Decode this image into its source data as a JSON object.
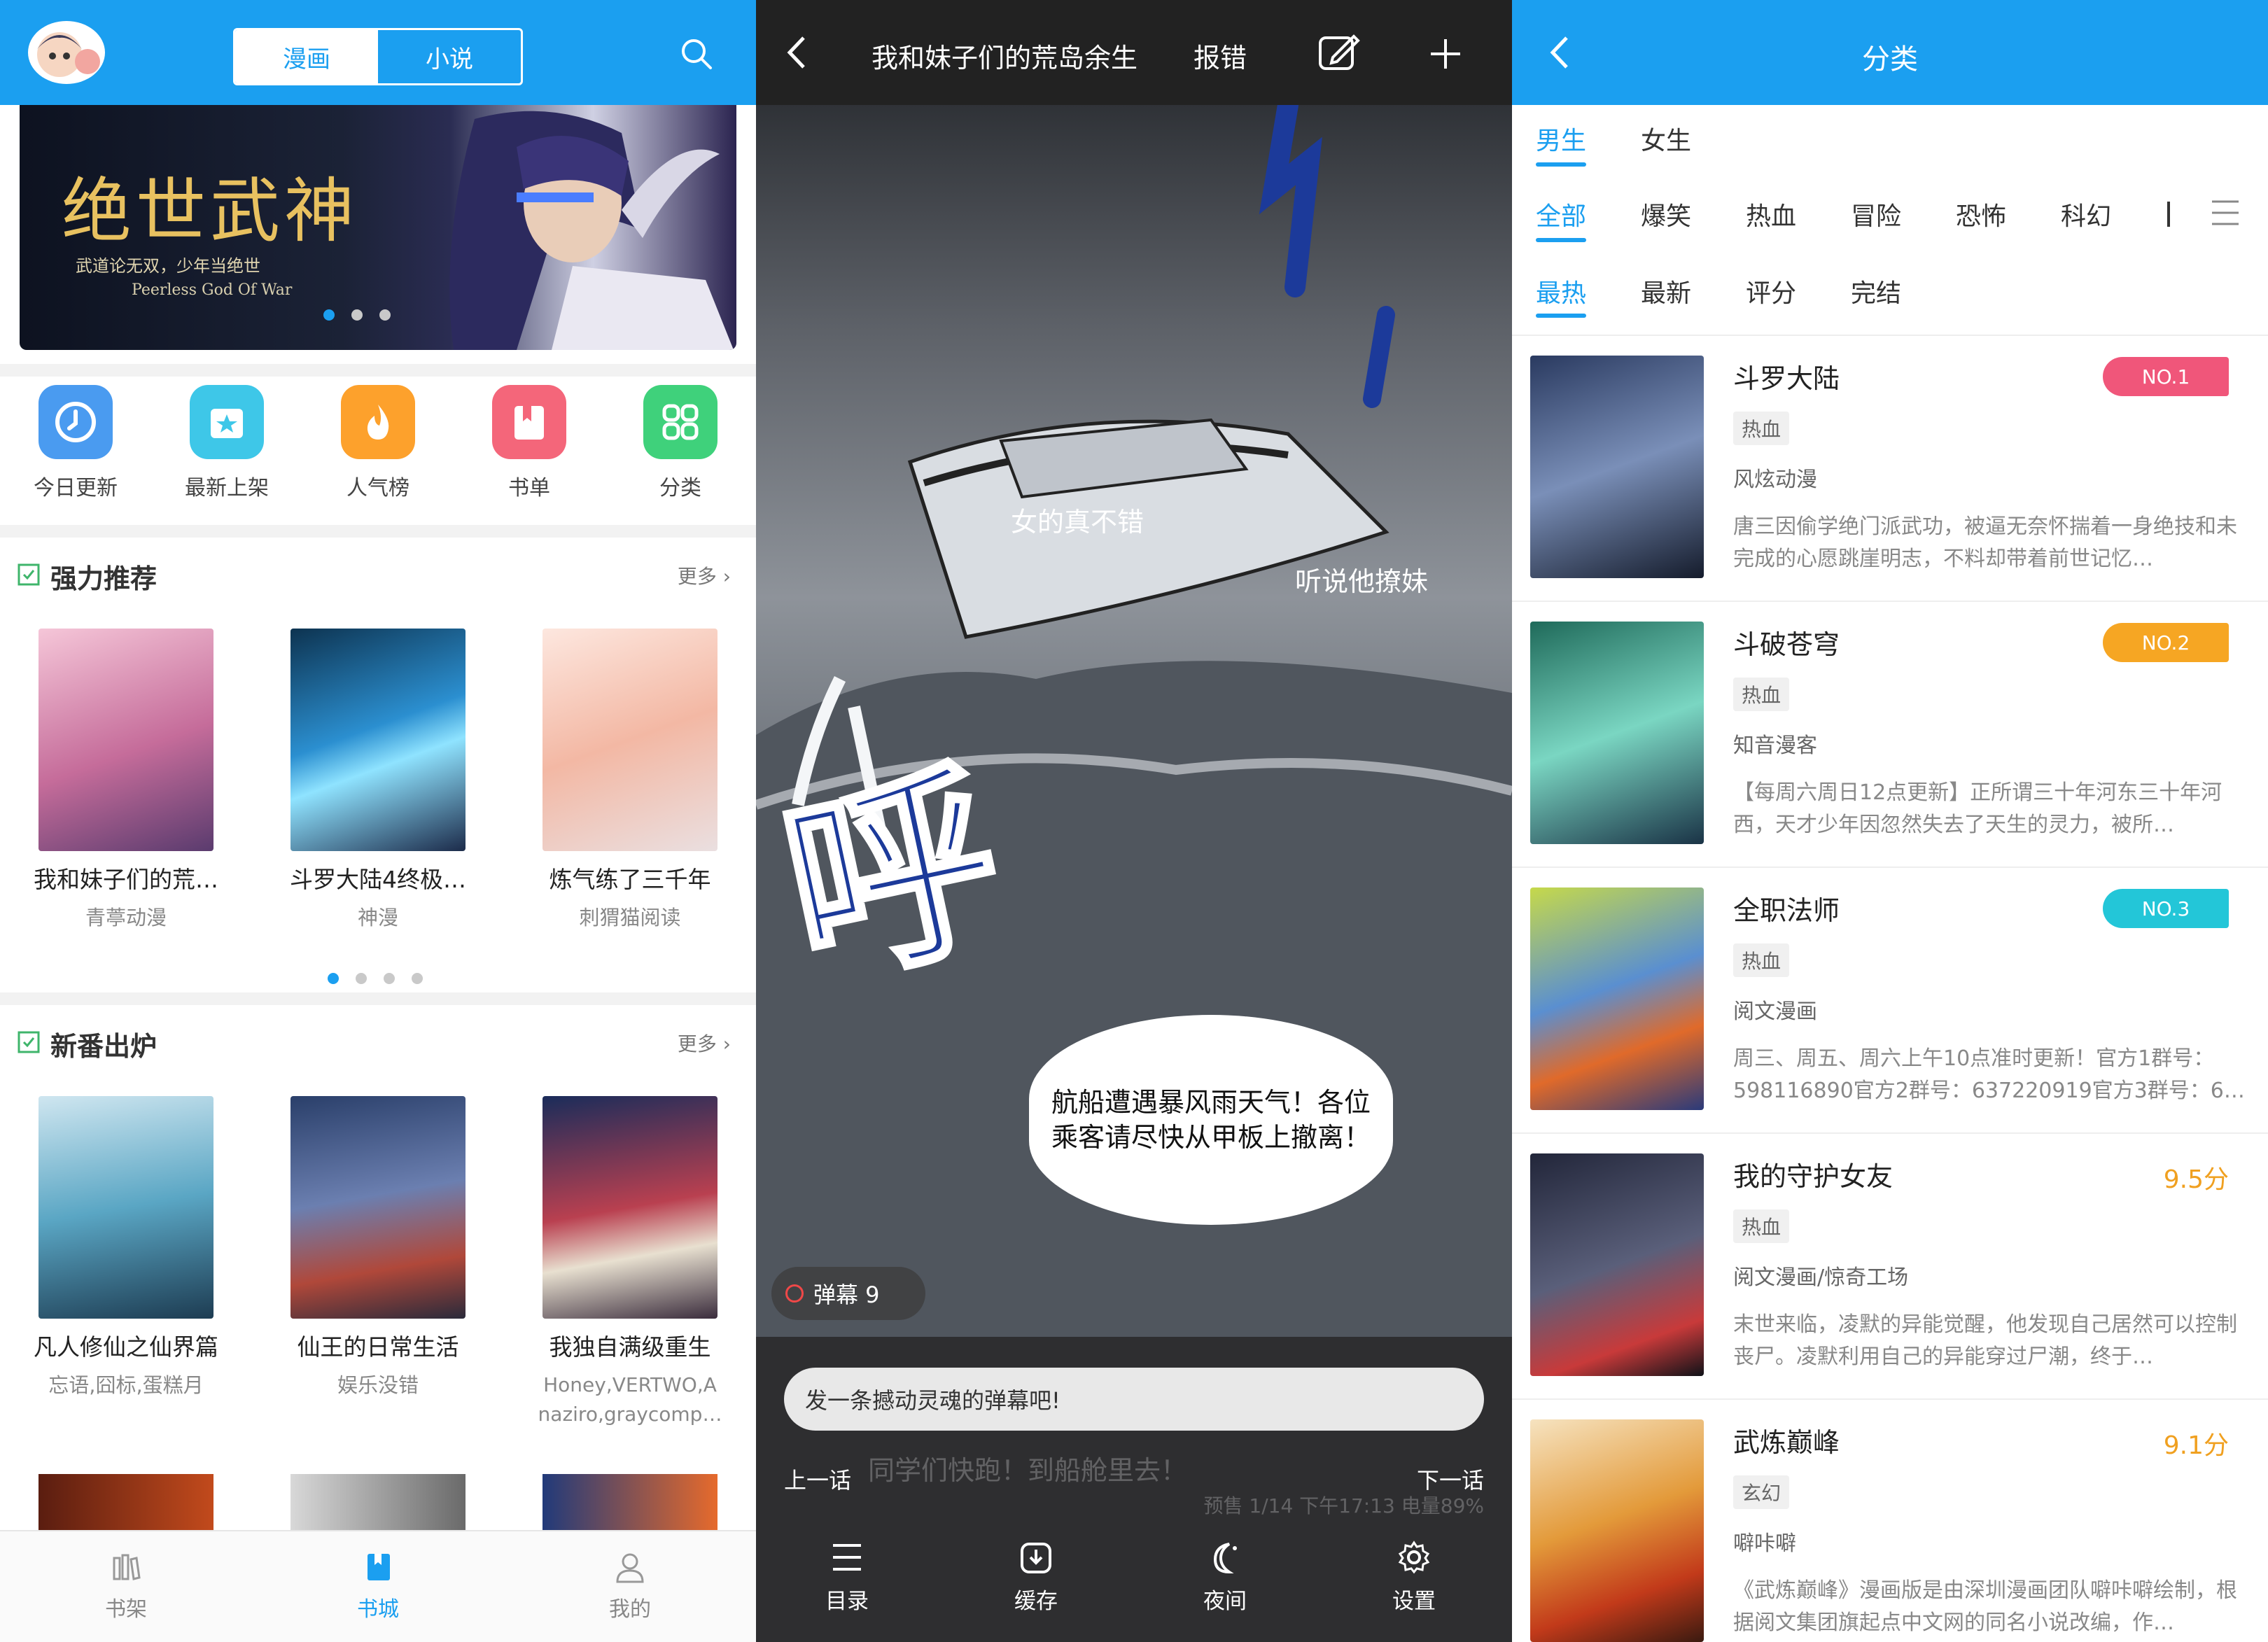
{
  "home": {
    "tabs": [
      "漫画",
      "小说"
    ],
    "banner": {
      "title": "绝世武神",
      "subtitle": "武道论无双，少年当绝世",
      "english": "Peerless God Of War"
    },
    "quick": [
      {
        "label": "今日更新",
        "icon": "clock-icon",
        "color": "#4a9bf0"
      },
      {
        "label": "最新上架",
        "icon": "star-box-icon",
        "color": "#3ec7e8"
      },
      {
        "label": "人气榜",
        "icon": "flame-icon",
        "color": "#fda12c"
      },
      {
        "label": "书单",
        "icon": "book-mark-icon",
        "color": "#f4667a"
      },
      {
        "label": "分类",
        "icon": "grid-icon",
        "color": "#3fd17b"
      }
    ],
    "sections": [
      {
        "title": "强力推荐",
        "more": "更多",
        "books": [
          {
            "name": "我和妹子们的荒…",
            "author": "青葶动漫"
          },
          {
            "name": "斗罗大陆4终极…",
            "author": "神漫"
          },
          {
            "name": "炼气练了三千年",
            "author": "刺猬猫阅读"
          }
        ]
      },
      {
        "title": "新番出炉",
        "more": "更多",
        "books": [
          {
            "name": "凡人修仙之仙界篇",
            "author": "忘语,囧标,蛋糕月"
          },
          {
            "name": "仙王的日常生活",
            "author": "娱乐没错"
          },
          {
            "name": "我独自满级重生",
            "author": "Honey,VERTWO,A naziro,graycomp…"
          }
        ]
      }
    ],
    "bottom_nav": [
      {
        "label": "书架",
        "icon": "shelf-icon"
      },
      {
        "label": "书城",
        "icon": "bookstore-icon"
      },
      {
        "label": "我的",
        "icon": "person-icon"
      }
    ]
  },
  "reader": {
    "title": "我和妹子们的荒岛余生",
    "report": "报错",
    "danmaku": [
      "女的真不错",
      "听说他撩妹"
    ],
    "speech": "航船遭遇暴风雨天气！各位乘客请尽快从甲板上撤离！",
    "sfx": "呼",
    "danmaku_badge": "弹幕 9",
    "input_placeholder": "发一条撼动灵魂的弹幕吧!",
    "prev": "上一话",
    "next": "下一话",
    "faint_caption": "同学们快跑！到船舱里去！",
    "status": "预售 1/14 下午17:13 电量89%",
    "tools": [
      {
        "label": "目录",
        "icon": "list-icon"
      },
      {
        "label": "缓存",
        "icon": "download-icon"
      },
      {
        "label": "夜间",
        "icon": "moon-icon"
      },
      {
        "label": "设置",
        "icon": "gear-icon"
      }
    ]
  },
  "category": {
    "title": "分类",
    "gender": [
      "男生",
      "女生"
    ],
    "genres": [
      "全部",
      "爆笑",
      "热血",
      "冒险",
      "恐怖",
      "科幻"
    ],
    "sorts": [
      "最热",
      "最新",
      "评分",
      "完结"
    ],
    "books": [
      {
        "name": "斗罗大陆",
        "tag": "热血",
        "author": "风炫动漫",
        "desc": "唐三因偷学绝门派武功，被逼无奈怀揣着一身绝技和未完成的心愿跳崖明志，不料却带着前世记忆…",
        "rank": "NO.1",
        "rank_color": "#f0567a"
      },
      {
        "name": "斗破苍穹",
        "tag": "热血",
        "author": "知音漫客",
        "desc": "【每周六周日12点更新】正所谓三十年河东三十年河西，天才少年因忽然失去了天生的灵力，被所…",
        "rank": "NO.2",
        "rank_color": "#f6a623"
      },
      {
        "name": "全职法师",
        "tag": "热血",
        "author": "阅文漫画",
        "desc": "周三、周五、周六上午10点准时更新！官方1群号：598116890官方2群号：637220919官方3群号：6…",
        "rank": "NO.3",
        "rank_color": "#23c6d8"
      },
      {
        "name": "我的守护女友",
        "tag": "热血",
        "author": "阅文漫画/惊奇工场",
        "desc": "末世来临，凌默的异能觉醒，他发现自己居然可以控制丧尸。凌默利用自己的异能穿过尸潮，终于…",
        "score": "9.5分"
      },
      {
        "name": "武炼巅峰",
        "tag": "玄幻",
        "author": "噼咔噼",
        "desc": "《武炼巅峰》漫画版是由深圳漫画团队噼咔噼绘制，根据阅文集团旗起点中文网的同名小说改编，作…",
        "score": "9.1分"
      }
    ]
  },
  "colors": {
    "accent": "#1b9ff0",
    "score": "#f0a020"
  }
}
